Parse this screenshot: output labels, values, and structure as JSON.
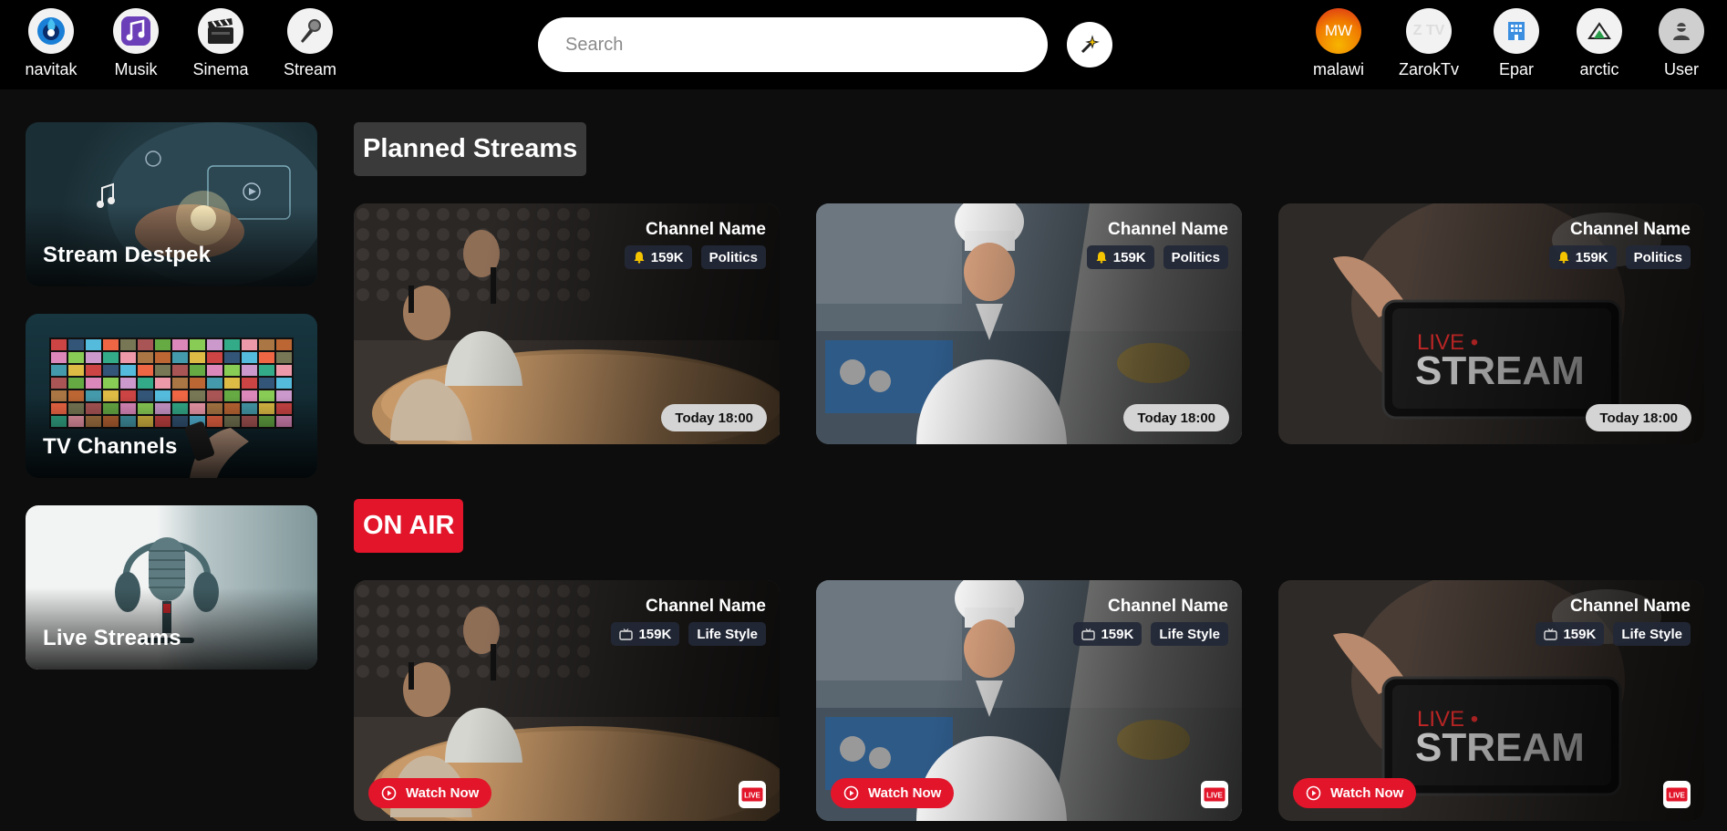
{
  "top_apps": [
    {
      "label": "navitak",
      "icon": "navitak-logo-icon"
    },
    {
      "label": "Musik",
      "icon": "music-note-icon"
    },
    {
      "label": "Sinema",
      "icon": "clapperboard-icon"
    },
    {
      "label": "Stream",
      "icon": "microphone-icon"
    }
  ],
  "search": {
    "placeholder": "Search",
    "value": ""
  },
  "magic_button": {
    "icon": "sparkle-wand-icon"
  },
  "right_apps": [
    {
      "label": "malawi",
      "icon_text": "MW"
    },
    {
      "label": "ZarokTv",
      "icon_text": "Z TV"
    },
    {
      "label": "Epar",
      "icon": "building-icon"
    },
    {
      "label": "arctic",
      "icon": "mountain-icon"
    },
    {
      "label": "User",
      "icon": "user-avatar-icon"
    }
  ],
  "sidebar": [
    {
      "title": "Stream Destpek"
    },
    {
      "title": "TV Channels"
    },
    {
      "title": "Live Streams"
    }
  ],
  "planned": {
    "title": "Planned Streams",
    "cards": [
      {
        "channel": "Channel Name",
        "followers": "159K",
        "category": "Politics",
        "time": "Today 18:00"
      },
      {
        "channel": "Channel Name",
        "followers": "159K",
        "category": "Politics",
        "time": "Today 18:00"
      },
      {
        "channel": "Channel Name",
        "followers": "159K",
        "category": "Politics",
        "time": "Today 18:00"
      }
    ]
  },
  "onair": {
    "title": "ON AIR",
    "watch_label": "Watch Now",
    "cards": [
      {
        "channel": "Channel Name",
        "viewers": "159K",
        "category": "Life Style"
      },
      {
        "channel": "Channel Name",
        "viewers": "159K",
        "category": "Life Style"
      },
      {
        "channel": "Channel Name",
        "viewers": "159K",
        "category": "Life Style"
      }
    ]
  },
  "thumb_text": {
    "live": "LIVE •",
    "stream": "STREAM",
    "badge": "LIVE"
  },
  "colors": {
    "accent_red": "#e2152a",
    "background": "#0d0d0d",
    "topbar": "#000000"
  }
}
